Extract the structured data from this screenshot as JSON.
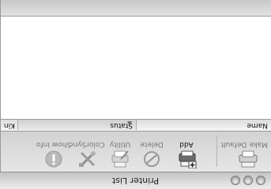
{
  "window": {
    "title": "Printer List"
  },
  "toolbar": {
    "items": [
      {
        "label": "Make Default",
        "icon": "printer-default-icon"
      },
      {
        "label": "Add",
        "icon": "printer-add-icon"
      },
      {
        "label": "Delete",
        "icon": "delete-icon"
      },
      {
        "label": "Utility",
        "icon": "printer-utility-icon"
      },
      {
        "label": "ColorSync",
        "icon": "colorsync-tools-icon"
      },
      {
        "label": "Show Info",
        "icon": "info-icon"
      }
    ]
  },
  "table": {
    "columns": [
      "Name",
      "Status",
      "Kin"
    ],
    "sort_indicator": "▲"
  }
}
